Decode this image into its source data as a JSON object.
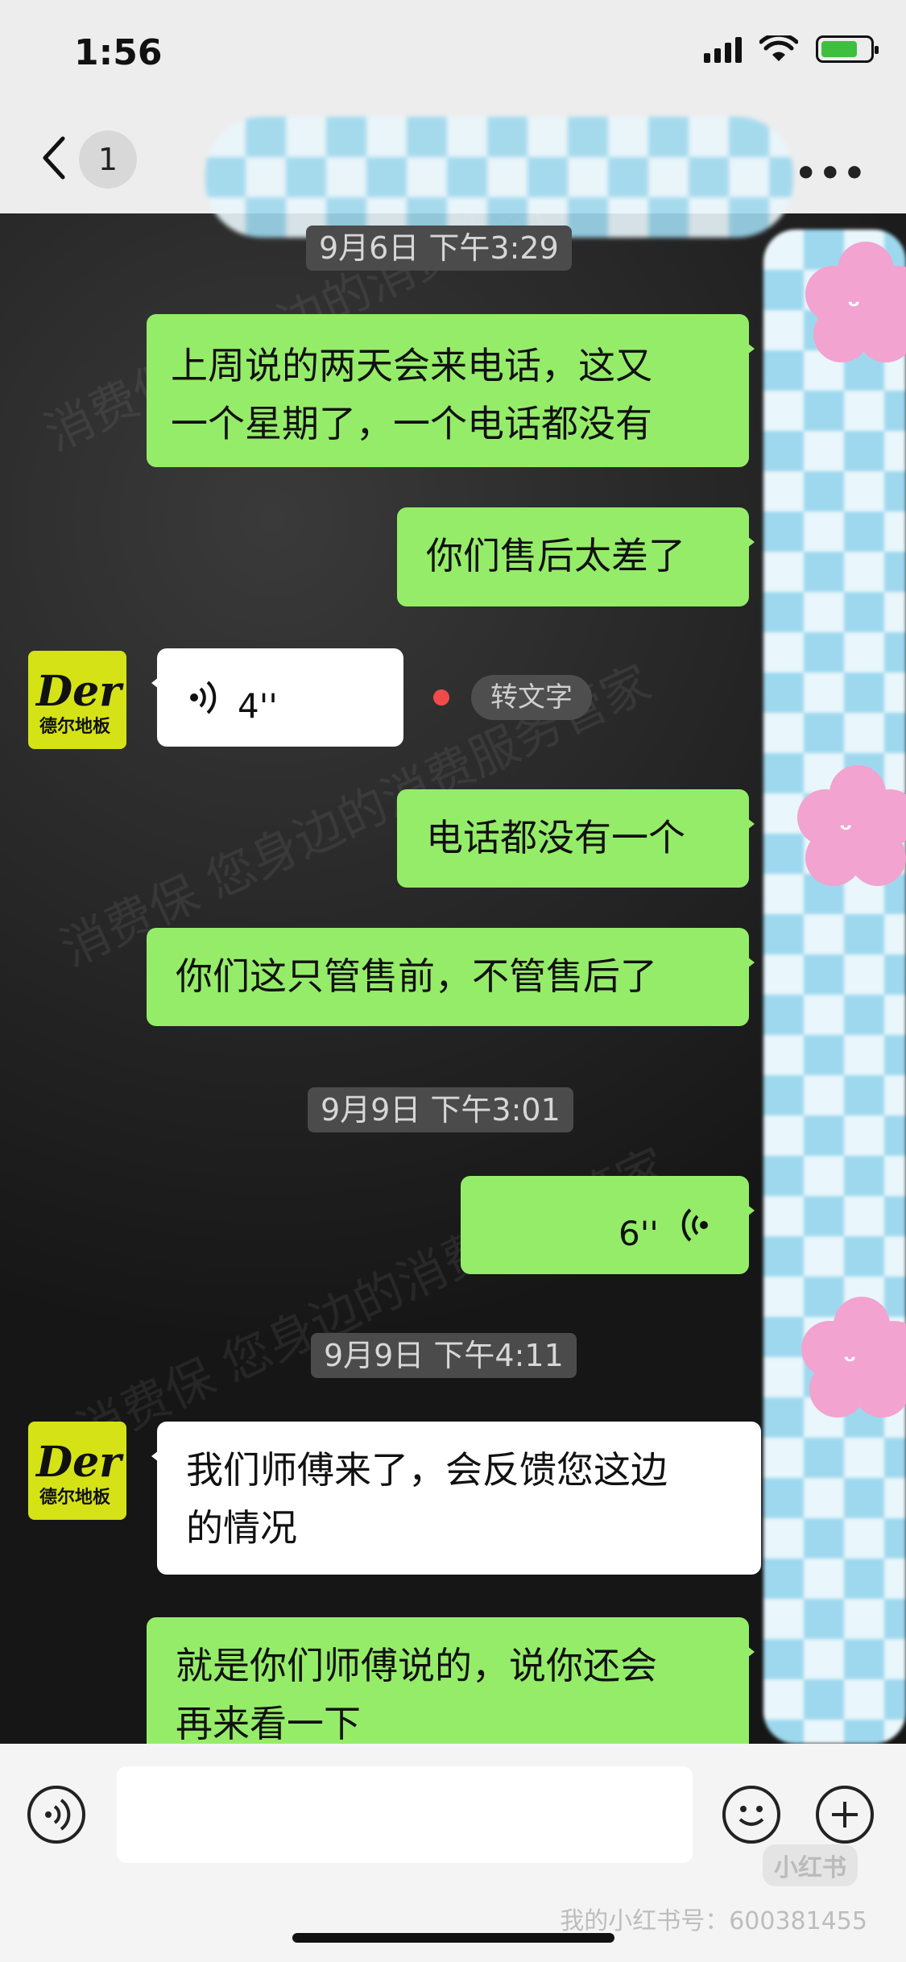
{
  "status_bar": {
    "time": "1:56"
  },
  "header": {
    "back_count": "1",
    "more_label": "•••"
  },
  "chat": {
    "stamps": [
      "9月6日 下午3:29",
      "9月9日 下午3:01",
      "9月9日 下午4:11"
    ],
    "messages": [
      {
        "side": "me",
        "type": "text",
        "lines": [
          "上周说的两天会来电话，这又",
          "一个星期了，一个电话都没有"
        ]
      },
      {
        "side": "me",
        "type": "text",
        "lines": [
          "你们售后太差了"
        ]
      },
      {
        "side": "other",
        "type": "voice",
        "duration": "4''",
        "convert_label": "转文字"
      },
      {
        "side": "me",
        "type": "text",
        "lines": [
          "电话都没有一个"
        ]
      },
      {
        "side": "me",
        "type": "text",
        "lines": [
          "你们这只管售前，不管售后了"
        ]
      },
      {
        "side": "me",
        "type": "voice",
        "duration": "6''"
      },
      {
        "side": "other",
        "type": "text",
        "lines": [
          "我们师傅来了，会反馈您这边",
          "的情况"
        ]
      },
      {
        "side": "me",
        "type": "text",
        "lines": [
          "就是你们师傅说的，说你还会",
          "再来看一下"
        ]
      }
    ],
    "avatar": {
      "logo": "Der",
      "sub": "德尔地板"
    },
    "watermark": "消费保 您身边的消费服务管家"
  },
  "footer": {
    "account": "我的小红书号：600381455",
    "xhs_logo": "小红书"
  },
  "colors": {
    "my_bubble": "#95ec69",
    "other_bubble": "#ffffff",
    "brand_avatar": "#d5e316"
  }
}
